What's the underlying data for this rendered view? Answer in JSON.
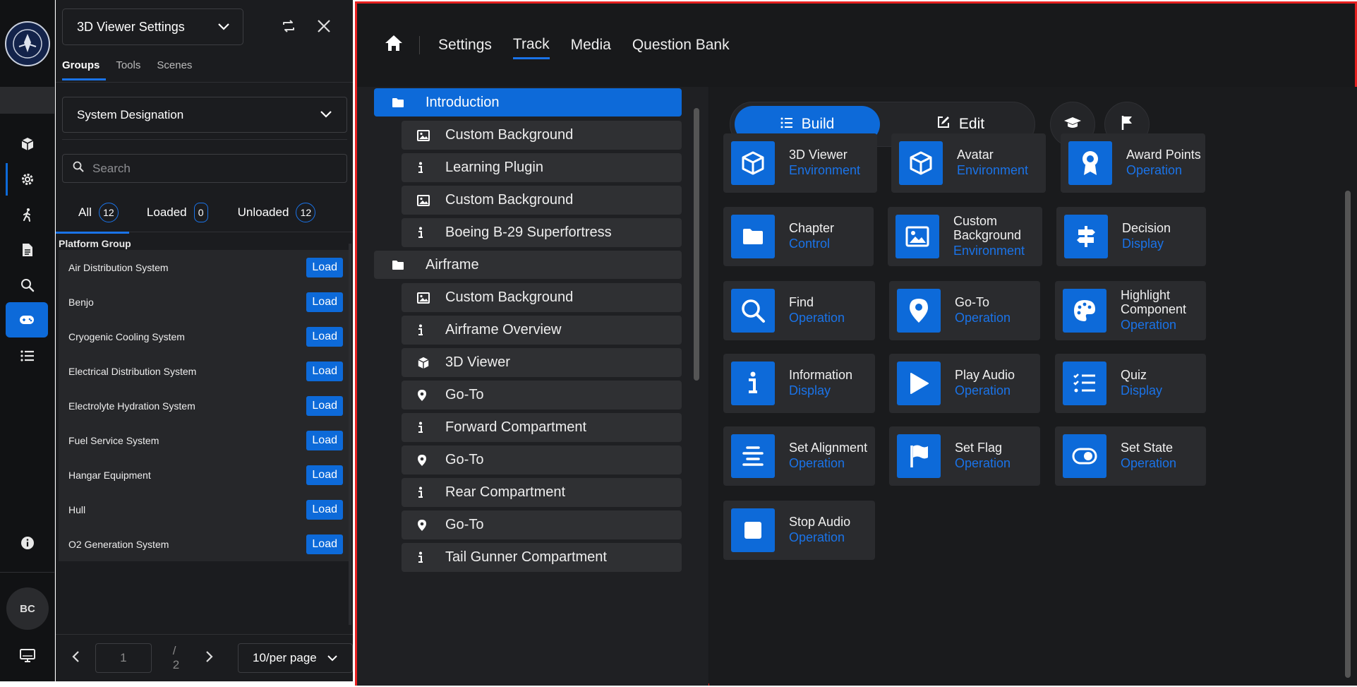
{
  "header": {
    "viewer_select": "3D Viewer Settings"
  },
  "tabs": [
    "Groups",
    "Tools",
    "Scenes"
  ],
  "designation": "System Designation",
  "search": {
    "placeholder": "Search"
  },
  "filters": {
    "all": {
      "label": "All",
      "count": "12"
    },
    "loaded": {
      "label": "Loaded",
      "count": "0"
    },
    "unloaded": {
      "label": "Unloaded",
      "count": "12"
    }
  },
  "group_name": "Platform Group",
  "load_label": "Load",
  "systems": [
    "Air Distribution System",
    "Benjo",
    "Cryogenic Cooling System",
    "Electrical Distribution System",
    "Electrolyte Hydration System",
    "Fuel Service System",
    "Hangar Equipment",
    "Hull",
    "O2 Generation System"
  ],
  "pagination": {
    "page": "1",
    "total": "/ 2",
    "per_page": "10/per page"
  },
  "user_initials": "BC",
  "topnav": [
    "Settings",
    "Track",
    "Media",
    "Question Bank"
  ],
  "tree": [
    {
      "label": "Introduction",
      "level": "top",
      "icon": "folder-icon"
    },
    {
      "label": "Custom Background",
      "level": "sub",
      "icon": "image-icon"
    },
    {
      "label": "Learning Plugin",
      "level": "sub",
      "icon": "info-icon"
    },
    {
      "label": "Custom Background",
      "level": "sub",
      "icon": "image-icon"
    },
    {
      "label": "Boeing B-29 Superfortress",
      "level": "sub",
      "icon": "info-icon"
    },
    {
      "label": "Airframe",
      "level": "top",
      "icon": "folder-icon"
    },
    {
      "label": "Custom Background",
      "level": "sub",
      "icon": "image-icon"
    },
    {
      "label": "Airframe Overview",
      "level": "sub",
      "icon": "info-icon"
    },
    {
      "label": "3D Viewer",
      "level": "sub",
      "icon": "cube-icon"
    },
    {
      "label": "Go-To",
      "level": "sub",
      "icon": "pin-icon"
    },
    {
      "label": "Forward Compartment",
      "level": "sub",
      "icon": "info-icon"
    },
    {
      "label": "Go-To",
      "level": "sub",
      "icon": "pin-icon"
    },
    {
      "label": "Rear Compartment",
      "level": "sub",
      "icon": "info-icon"
    },
    {
      "label": "Go-To",
      "level": "sub",
      "icon": "pin-icon"
    },
    {
      "label": "Tail Gunner Compartment",
      "level": "sub",
      "icon": "info-icon"
    }
  ],
  "mode": {
    "build": "Build",
    "edit": "Edit"
  },
  "components": [
    {
      "title": "3D Viewer",
      "sub": "Environment",
      "icon": "cube-icon"
    },
    {
      "title": "Avatar",
      "sub": "Environment",
      "icon": "cube-icon"
    },
    {
      "title": "Award Points",
      "sub": "Operation",
      "icon": "award-icon"
    },
    {
      "title": "Chapter",
      "sub": "Control",
      "icon": "folder-icon"
    },
    {
      "title": "Custom Background",
      "sub": "Environment",
      "icon": "image-icon"
    },
    {
      "title": "Decision",
      "sub": "Display",
      "icon": "signpost-icon"
    },
    {
      "title": "Find",
      "sub": "Operation",
      "icon": "search-icon"
    },
    {
      "title": "Go-To",
      "sub": "Operation",
      "icon": "pin-icon"
    },
    {
      "title": "Highlight Component",
      "sub": "Operation",
      "icon": "palette-icon"
    },
    {
      "title": "Information",
      "sub": "Display",
      "icon": "info-icon"
    },
    {
      "title": "Play Audio",
      "sub": "Operation",
      "icon": "play-icon"
    },
    {
      "title": "Quiz",
      "sub": "Display",
      "icon": "checklist-icon"
    },
    {
      "title": "Set Alignment",
      "sub": "Operation",
      "icon": "align-icon"
    },
    {
      "title": "Set Flag",
      "sub": "Operation",
      "icon": "flag-icon"
    },
    {
      "title": "Set State",
      "sub": "Operation",
      "icon": "toggle-icon"
    },
    {
      "title": "Stop Audio",
      "sub": "Operation",
      "icon": "stop-icon"
    }
  ]
}
